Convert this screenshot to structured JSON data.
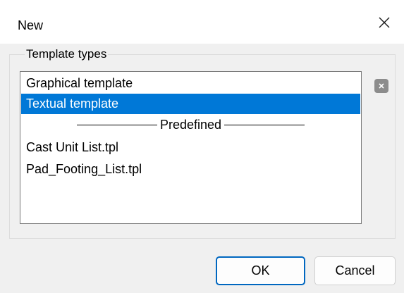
{
  "window": {
    "title": "New",
    "close_icon": "close-icon"
  },
  "group": {
    "legend": "Template types"
  },
  "list": {
    "items": [
      {
        "label": "Graphical template",
        "selected": false
      },
      {
        "label": "Textual template",
        "selected": true
      }
    ],
    "separator_label": "Predefined",
    "predefined_items": [
      {
        "label": "Cast Unit List.tpl"
      },
      {
        "label": "Pad_Footing_List.tpl"
      }
    ]
  },
  "side_button": {
    "icon": "delete-icon"
  },
  "buttons": {
    "ok_label": "OK",
    "cancel_label": "Cancel"
  },
  "colors": {
    "selection": "#0078d7",
    "ok_border": "#0067c0",
    "background": "#f0f0f0"
  }
}
